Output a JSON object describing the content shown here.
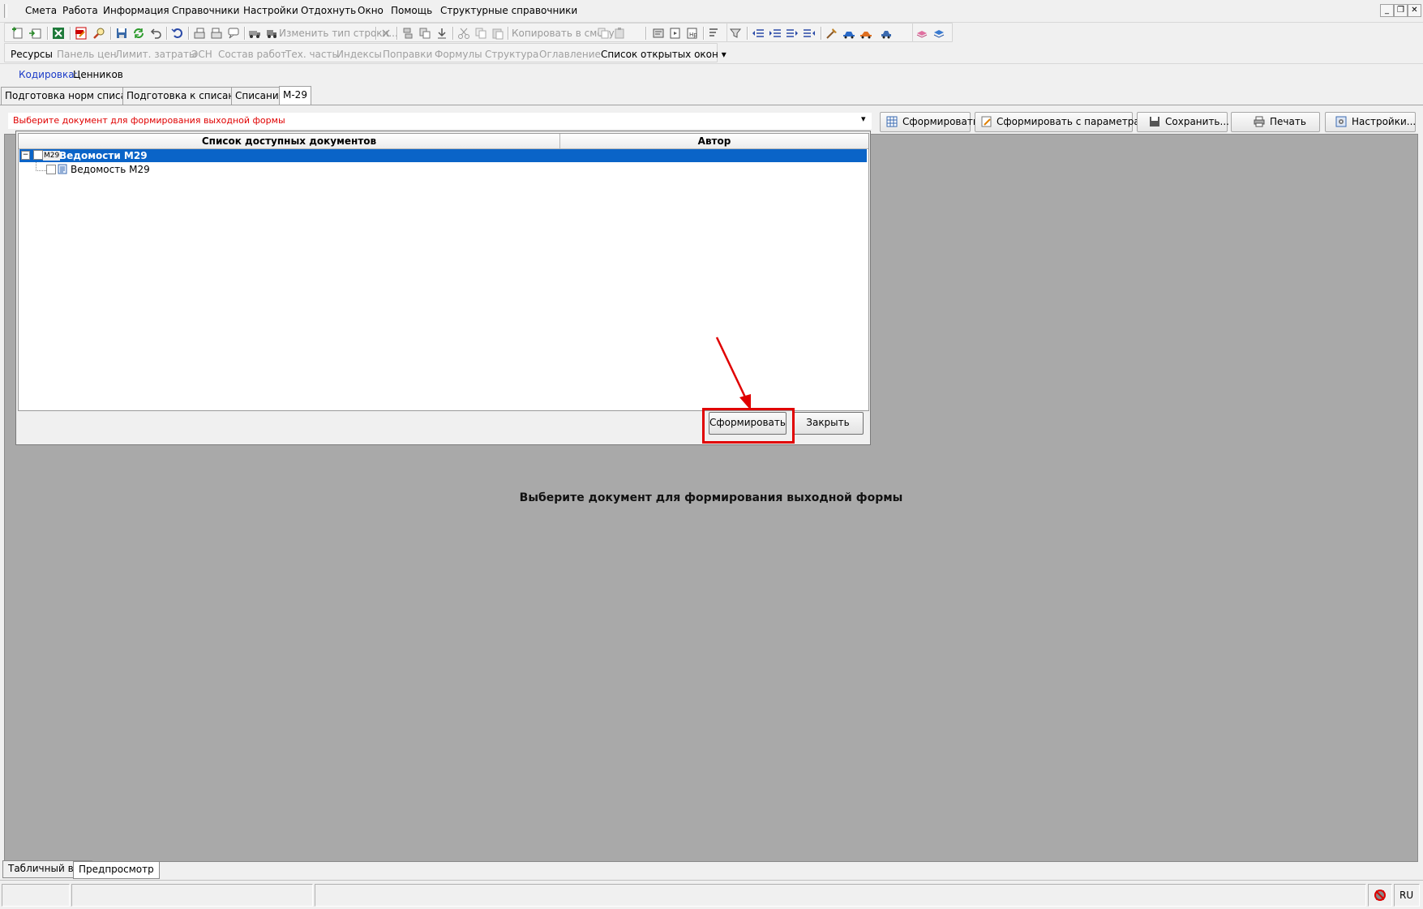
{
  "menu": [
    "Смета",
    "Работа",
    "Информация",
    "Справочники",
    "Настройки",
    "Отдохнуть",
    "Окно",
    "Помощь",
    "Структурные справочники"
  ],
  "window_controls": [
    "_",
    "❐",
    "✕"
  ],
  "toolbar1": {
    "change_row_type": "Изменить тип строки...",
    "copy_to_estimate": "Копировать в смету"
  },
  "toolbar2": {
    "items": [
      "Ресурсы",
      "Панель цен",
      "Лимит. затраты",
      "ЭСН",
      "Состав работ",
      "Тех. часть",
      "Индексы",
      "Поправки",
      "Формулы",
      "Структура",
      "Оглавление"
    ],
    "open_windows": "Список открытых окон"
  },
  "codification": {
    "label": "Кодировка:",
    "value": "Ценников"
  },
  "tabs": [
    "Подготовка норм списания",
    "Подготовка к списанию",
    "Списание",
    "М-29"
  ],
  "document_bar": {
    "placeholder": "Выберите документ для формирования выходной формы",
    "buttons": [
      "Сформировать",
      "Сформировать с параметрами...",
      "Сохранить...",
      "Печать",
      "Настройки..."
    ]
  },
  "workspace_message": "Выберите документ для формирования выходной формы",
  "dialog": {
    "columns": [
      "Список доступных документов",
      "Автор"
    ],
    "tree": [
      {
        "icon_text": "М29",
        "label": "Ведомости М29",
        "selected": true
      },
      {
        "label": "Ведомость М29",
        "selected": false
      }
    ],
    "buttons": {
      "generate": "Сформировать",
      "close": "Закрыть"
    }
  },
  "bottom_tabs": [
    "Табличный вид",
    "Предпросмотр"
  ],
  "status": {
    "lang": "RU"
  },
  "colors": {
    "highlight": "#e00000",
    "selection": "#0a64c8",
    "workspace": "#a9a9a9",
    "hint_text": "#e00000"
  }
}
